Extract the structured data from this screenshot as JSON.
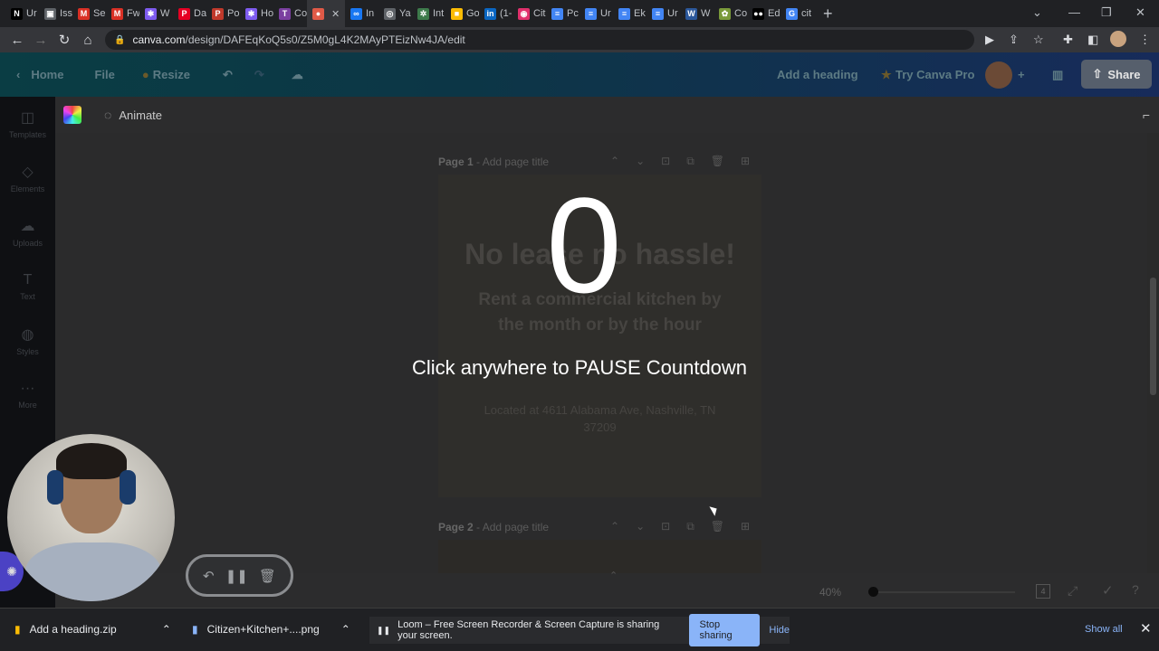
{
  "browser": {
    "tabs": [
      {
        "icon": "notion-icon",
        "text": "Ur",
        "color": "#000000",
        "glyph": "N"
      },
      {
        "icon": "cube-icon",
        "text": "Iss",
        "color": "#5f6368",
        "glyph": "▣"
      },
      {
        "icon": "gmail-icon",
        "text": "Se",
        "color": "#d93025",
        "glyph": "M"
      },
      {
        "icon": "gmail-icon",
        "text": "Fw",
        "color": "#d93025",
        "glyph": "M"
      },
      {
        "icon": "asterisk-icon",
        "text": "W",
        "color": "#7e5bef",
        "glyph": "✱"
      },
      {
        "icon": "pinterest-icon",
        "text": "Da",
        "color": "#e60023",
        "glyph": "P"
      },
      {
        "icon": "p-icon",
        "text": "Po",
        "color": "#c0392b",
        "glyph": "P"
      },
      {
        "icon": "asterisk-icon",
        "text": "Ho",
        "color": "#7e5bef",
        "glyph": "✱"
      },
      {
        "icon": "trello-icon",
        "text": "Co",
        "color": "#7b3fa0",
        "glyph": "T"
      },
      {
        "icon": "record-icon",
        "text": "",
        "color": "#e05a47",
        "glyph": "●",
        "active": true
      },
      {
        "icon": "meta-icon",
        "text": "In",
        "color": "#1877f2",
        "glyph": "∞"
      },
      {
        "icon": "globe-icon",
        "text": "Ya",
        "color": "#5f6368",
        "glyph": "◎"
      },
      {
        "icon": "sparkle-icon",
        "text": "Int",
        "color": "#3d7a4b",
        "glyph": "✲"
      },
      {
        "icon": "keep-icon",
        "text": "Go",
        "color": "#fbbc04",
        "glyph": "■"
      },
      {
        "icon": "linkedin-icon",
        "text": "(1-",
        "color": "#0a66c2",
        "glyph": "in"
      },
      {
        "icon": "instagram-icon",
        "text": "Cit",
        "color": "#e1306c",
        "glyph": "◉"
      },
      {
        "icon": "docs-icon",
        "text": "Pc",
        "color": "#4285f4",
        "glyph": "≡"
      },
      {
        "icon": "docs-icon",
        "text": "Ur",
        "color": "#4285f4",
        "glyph": "≡"
      },
      {
        "icon": "docs-icon",
        "text": "Ek",
        "color": "#4285f4",
        "glyph": "≡"
      },
      {
        "icon": "docs-icon",
        "text": "Ur",
        "color": "#4285f4",
        "glyph": "≡"
      },
      {
        "icon": "word-icon",
        "text": "W",
        "color": "#2b579a",
        "glyph": "W"
      },
      {
        "icon": "leaf-icon",
        "text": "Co",
        "color": "#7a9a3a",
        "glyph": "✿"
      },
      {
        "icon": "medium-icon",
        "text": "Ed",
        "color": "#000000",
        "glyph": "●●"
      },
      {
        "icon": "google-icon",
        "text": "cit",
        "color": "#4285f4",
        "glyph": "G"
      }
    ],
    "url_domain": "canva.com",
    "url_path": "/design/DAFEqKoQ5s0/Z5M0gL4K2MAyPTEizNw4JA/edit"
  },
  "canva": {
    "header": {
      "home": "Home",
      "file": "File",
      "resize": "Resize",
      "design_title": "Add a heading",
      "try_pro": "Try Canva Pro",
      "share": "Share"
    },
    "sidebar": [
      {
        "icon": "templates-icon",
        "label": "Templates",
        "glyph": "◫"
      },
      {
        "icon": "elements-icon",
        "label": "Elements",
        "glyph": "◇"
      },
      {
        "icon": "uploads-icon",
        "label": "Uploads",
        "glyph": "☁"
      },
      {
        "icon": "text-icon",
        "label": "Text",
        "glyph": "T"
      },
      {
        "icon": "styles-icon",
        "label": "Styles",
        "glyph": "◍"
      },
      {
        "icon": "more-icon",
        "label": "More",
        "glyph": "···"
      }
    ],
    "toolbar": {
      "animate": "Animate"
    },
    "page1": {
      "label": "Page 1",
      "title_placeholder": "- Add page title",
      "headline": "No lease no hassle!",
      "subline1": "Rent a commercial  kitchen by",
      "subline2": "the month or by the hour",
      "address1": "Located at  4611 Alabama Ave, Nashville, TN",
      "address2": "37209"
    },
    "page2": {
      "label": "Page 2",
      "title_placeholder": "- Add page title"
    },
    "zoom": "40%",
    "page_count": "4"
  },
  "countdown": {
    "number": "0",
    "message": "Click anywhere to PAUSE Countdown"
  },
  "downloads": {
    "items": [
      "Add a heading.zip",
      "Citizen+Kitchen+....png"
    ],
    "loom_notice": "Loom – Free Screen Recorder & Screen Capture is sharing your screen.",
    "stop_sharing": "Stop sharing",
    "hide": "Hide",
    "show_all": "Show all"
  }
}
